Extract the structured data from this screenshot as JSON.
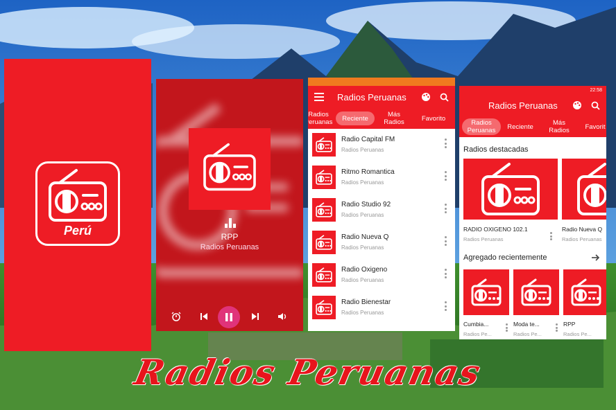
{
  "brand_color": "#EE1C25",
  "splash": {
    "country_label": "Perú"
  },
  "player": {
    "station": "RPP",
    "subtitle": "Radios Peruanas",
    "controls": [
      "alarm-icon",
      "previous-icon",
      "pause-icon",
      "next-icon",
      "volume-icon"
    ]
  },
  "list_screen": {
    "title": "Radios Peruanas",
    "tabs": [
      {
        "label": "Radios Peruanas",
        "active": false
      },
      {
        "label": "Reciente",
        "active": true
      },
      {
        "label": "Más Radios",
        "active": false
      },
      {
        "label": "Favorito",
        "active": false
      }
    ],
    "items": [
      {
        "title": "Radio Capital FM",
        "subtitle": "Radios Peruanas"
      },
      {
        "title": "Ritmo Romantica",
        "subtitle": "Radios Peruanas"
      },
      {
        "title": "Radio Studio 92",
        "subtitle": "Radios Peruanas"
      },
      {
        "title": "Radio Nueva Q",
        "subtitle": "Radios Peruanas"
      },
      {
        "title": "Radio Oxigeno",
        "subtitle": "Radios Peruanas"
      },
      {
        "title": "Radio Bienestar",
        "subtitle": "Radios Peruanas"
      }
    ]
  },
  "home_screen": {
    "title": "Radios Peruanas",
    "status_time": "22:58",
    "tabs": [
      {
        "label": "Radios Peruanas",
        "active": true
      },
      {
        "label": "Reciente",
        "active": false
      },
      {
        "label": "Más Radios",
        "active": false
      },
      {
        "label": "Favorit",
        "active": false
      }
    ],
    "featured_title": "Radios destacadas",
    "featured": [
      {
        "title": "RADIO OXIGENO 102.1",
        "subtitle": "Radios Peruanas"
      },
      {
        "title": "Radio Nueva Q",
        "subtitle": "Radios Peruanas"
      }
    ],
    "recent_title": "Agregado recientemente",
    "recent": [
      {
        "title": "Cumbia...",
        "subtitle": "Radios Pe..."
      },
      {
        "title": "Moda te...",
        "subtitle": "Radios Pe..."
      },
      {
        "title": "RPP",
        "subtitle": "Radios Pe..."
      }
    ]
  },
  "caption": "Radios Peruanas"
}
